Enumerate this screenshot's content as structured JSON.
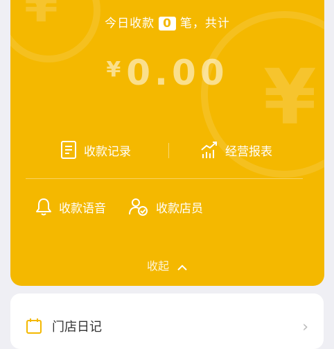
{
  "summary": {
    "today_prefix": "今日收款",
    "today_count": "0",
    "today_suffix": "笔，共计",
    "currency": "¥",
    "amount": "0.00"
  },
  "actions_row1": [
    {
      "label": "收款记录",
      "icon": "receipt-icon"
    },
    {
      "label": "经营报表",
      "icon": "trend-chart-icon"
    }
  ],
  "actions_row2": [
    {
      "label": "收款语音",
      "icon": "bell-icon"
    },
    {
      "label": "收款店员",
      "icon": "staff-check-icon"
    }
  ],
  "collapse_label": "收起",
  "store_card": {
    "label": "门店日记",
    "icon": "calendar-icon"
  },
  "colors": {
    "accent": "#f4b800",
    "background": "#efeff4"
  }
}
